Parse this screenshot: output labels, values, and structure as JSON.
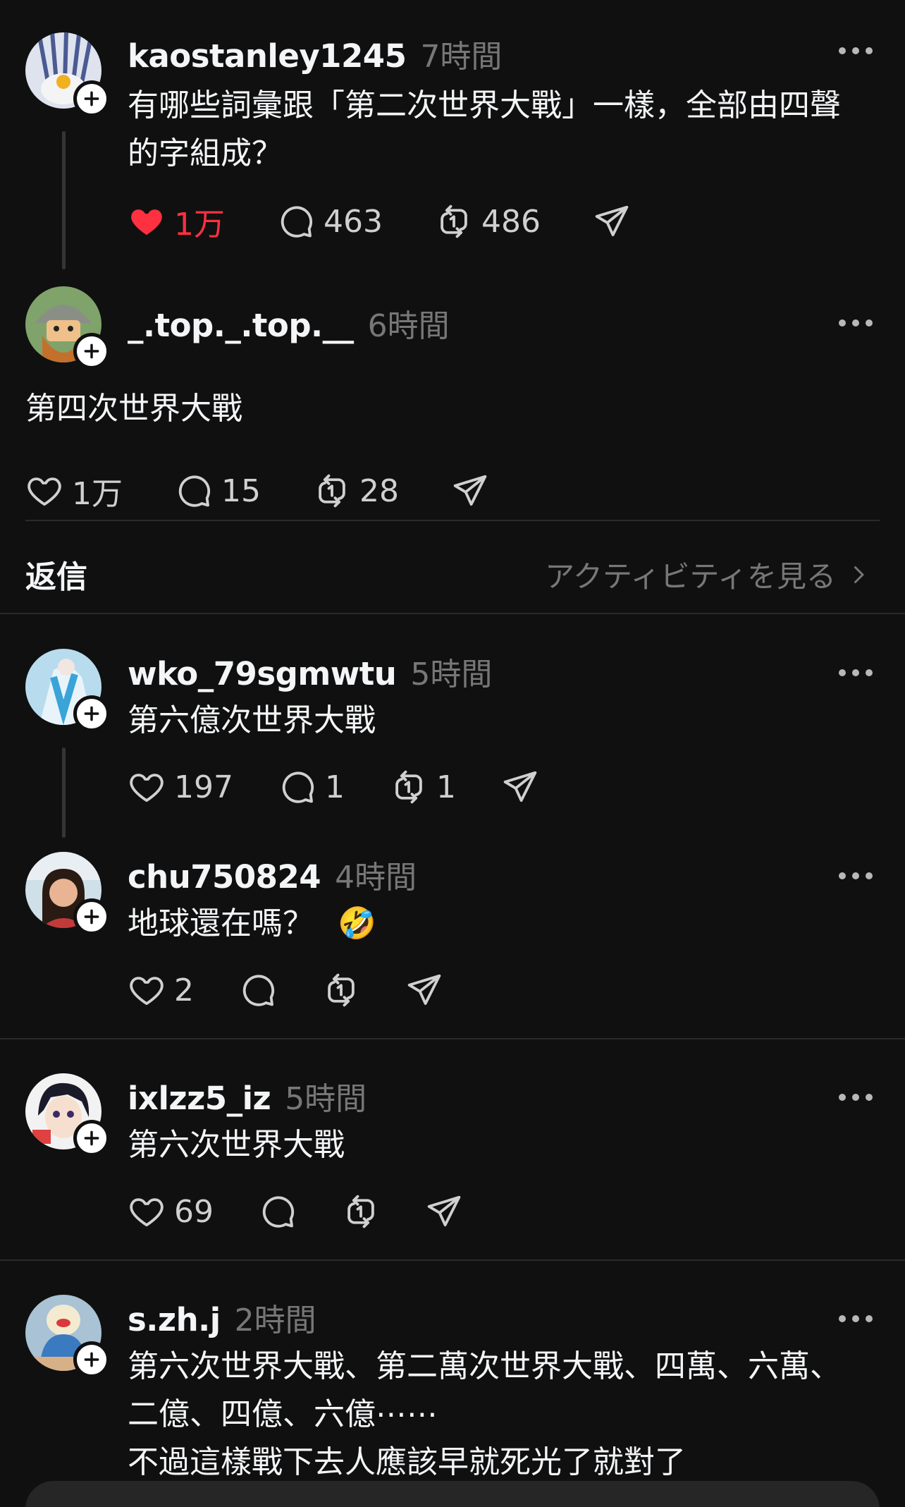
{
  "main_post": {
    "username": "kaostanley1245",
    "time": "7時間",
    "text": "有哪些詞彙跟「第二次世界大戰」一樣，全部由四聲的字組成？",
    "likes": "1万",
    "comments": "463",
    "reposts": "486"
  },
  "reply_post": {
    "username": "_.top._.top.__",
    "time": "6時間",
    "text": "第四次世界大戰",
    "likes": "1万",
    "comments": "15",
    "reposts": "28"
  },
  "replies_header": {
    "title": "返信",
    "activity_link": "アクティビティを見る"
  },
  "replies": [
    {
      "username": "wko_79sgmwtu",
      "time": "5時間",
      "text": "第六億次世界大戰",
      "likes": "197",
      "comments": "1",
      "reposts": "1"
    },
    {
      "username": "chu750824",
      "time": "4時間",
      "text": "地球還在嗎？",
      "emoji": "🤣",
      "likes": "2",
      "comments": "",
      "reposts": ""
    },
    {
      "username": "ixlzz5_iz",
      "time": "5時間",
      "text": "第六次世界大戰",
      "likes": "69",
      "comments": "",
      "reposts": ""
    },
    {
      "username": "s.zh.j",
      "time": "2時間",
      "text": "第六次世界大戰、第二萬次世界大戰、四萬、六萬、二億、四億、六億⋯⋯",
      "text2": "不過這樣戰下去人應該早就死光了就對了",
      "likes": "",
      "comments": "",
      "reposts": ""
    }
  ],
  "colors": {
    "background": "#101010",
    "like_active": "#ff3040",
    "muted": "#777777"
  },
  "icons": [
    "heart-icon",
    "comment-icon",
    "repost-icon",
    "share-icon",
    "more-icon",
    "follow-plus-icon",
    "chevron-right-icon"
  ]
}
